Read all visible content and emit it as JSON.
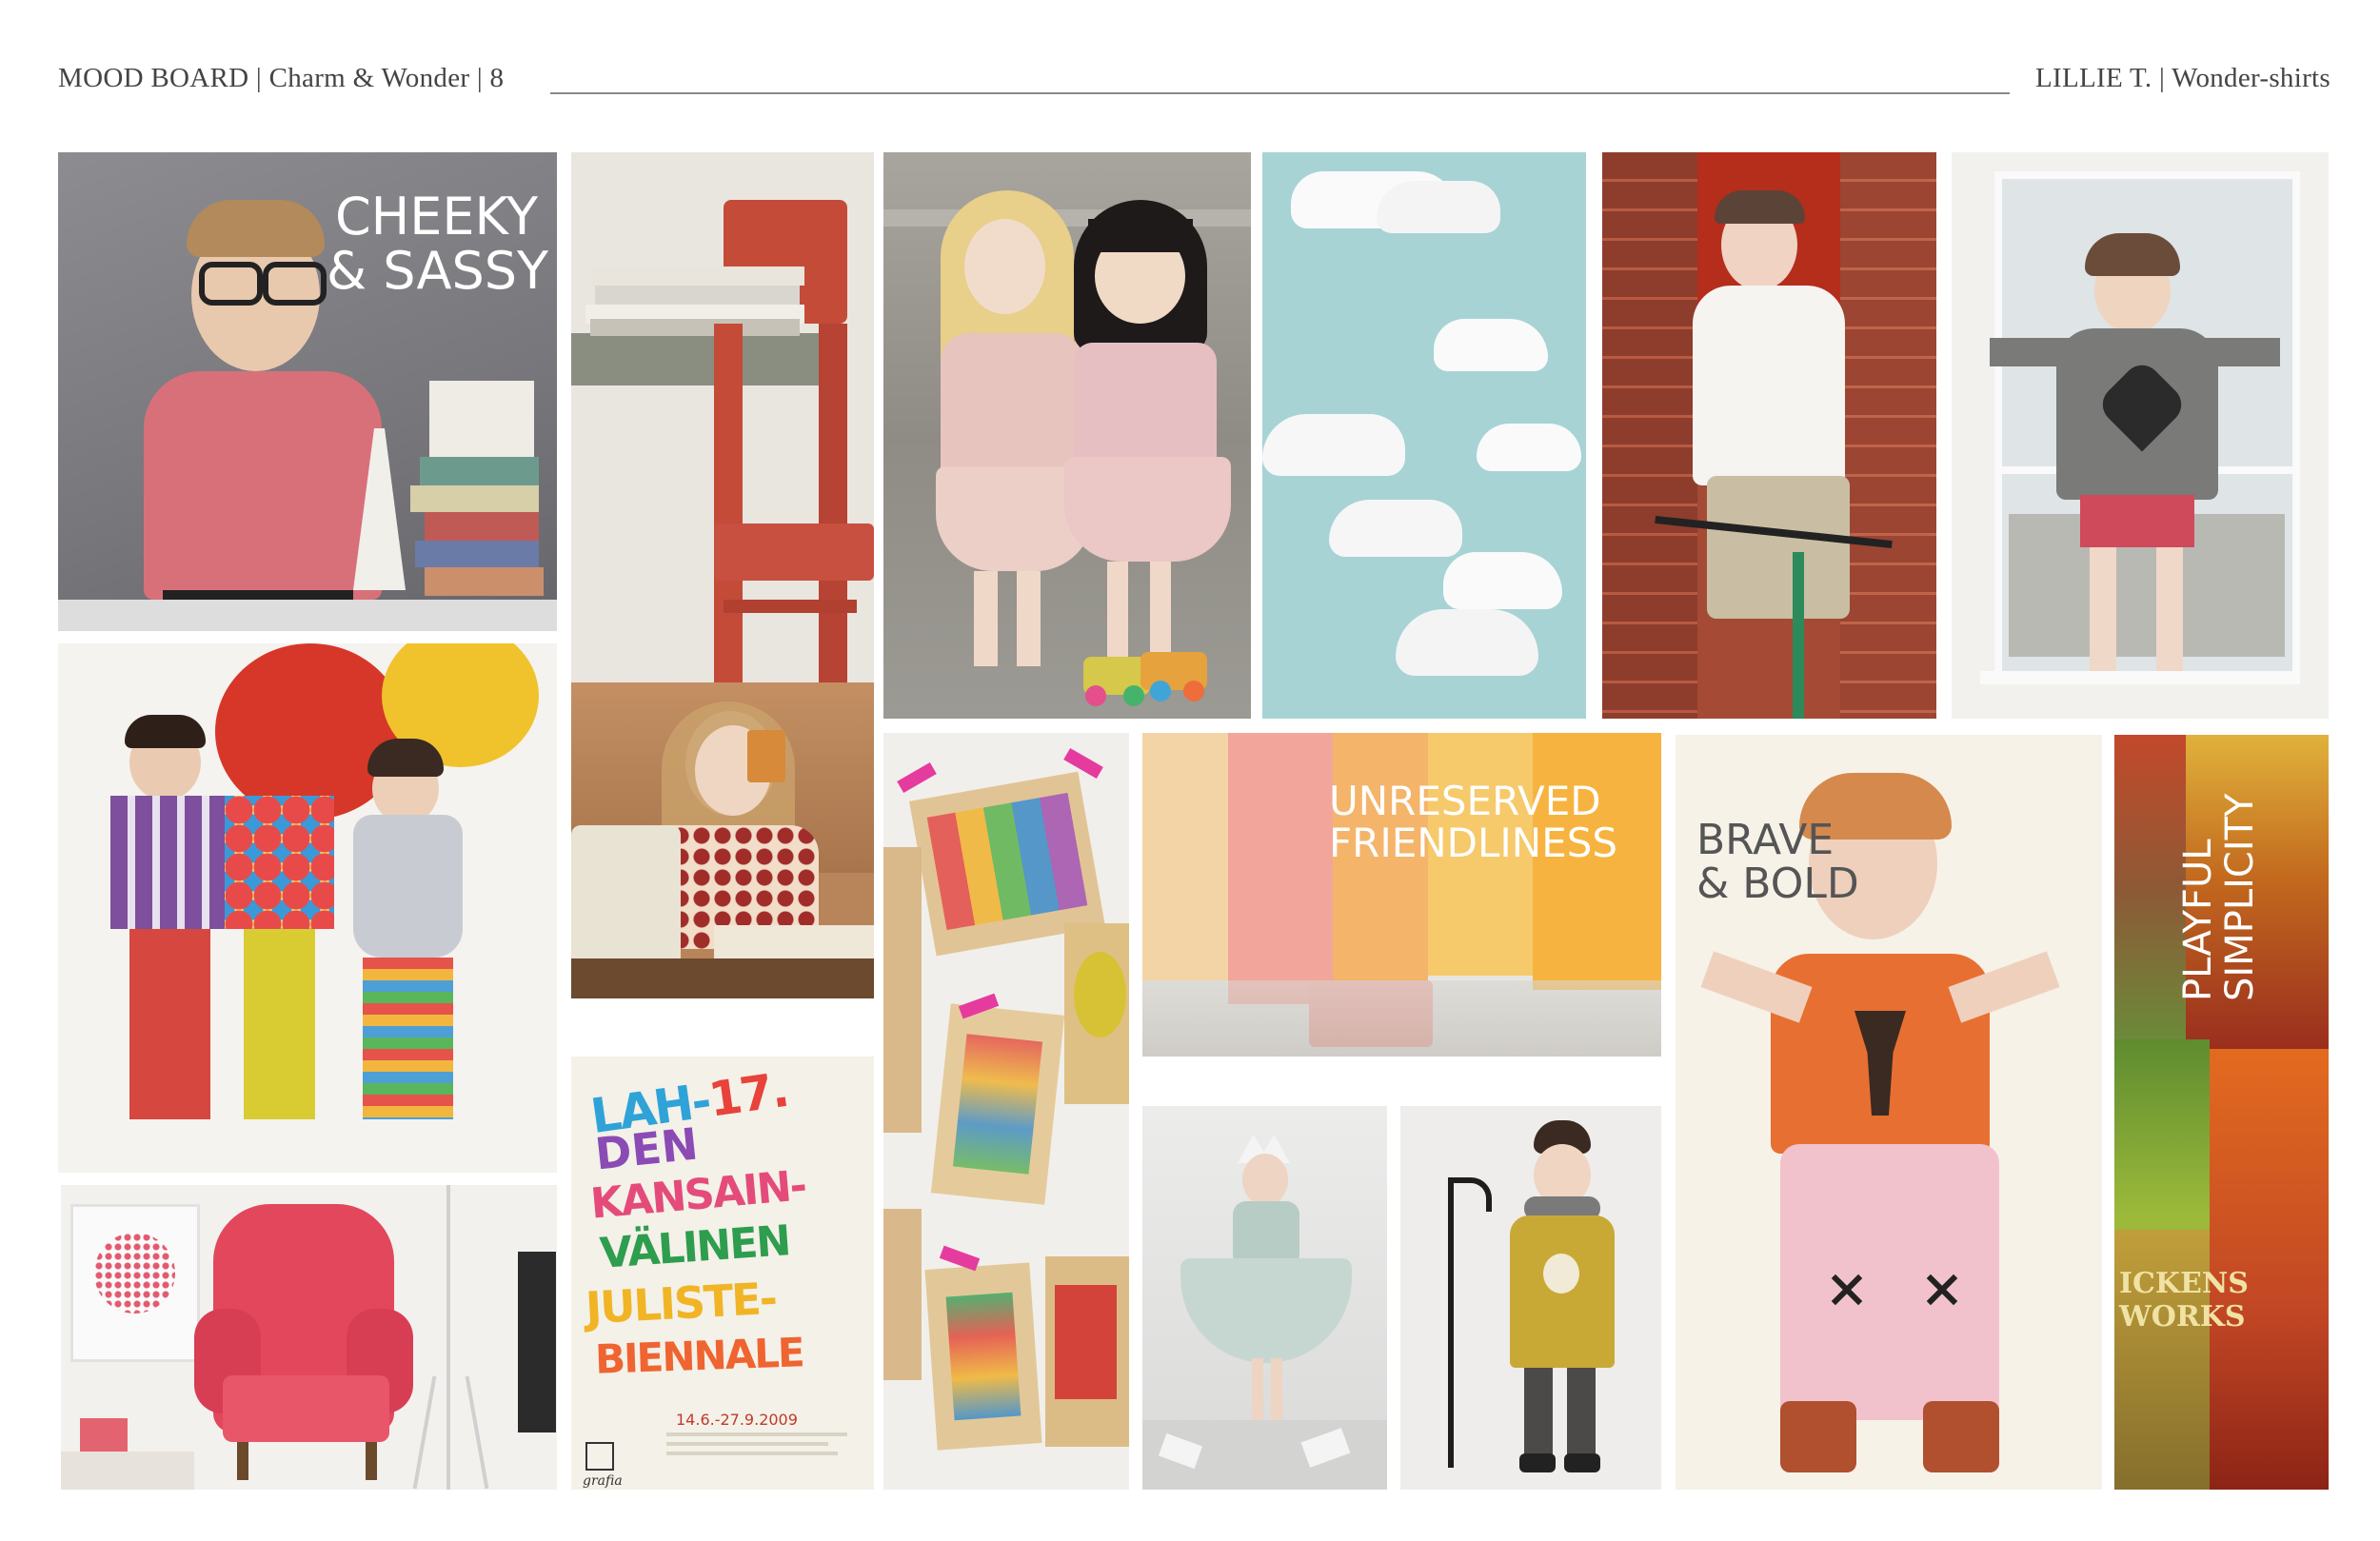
{
  "header": {
    "left": "MOOD BOARD | Charm & Wonder | 8",
    "right": "LILLIE T. | Wonder-shirts"
  },
  "captions": {
    "cheeky_line1": "CHEEKY",
    "cheeky_line2": "& SASSY",
    "unreserved_line1": "UNRESERVED",
    "unreserved_line2": "FRIENDLINESS",
    "brave_line1": "BRAVE",
    "brave_line2": "& BOLD",
    "playful_line1": "PLAYFUL",
    "playful_line2": "SIMPLICITY"
  },
  "poster": {
    "line1": "LAH-",
    "line1b": "17.",
    "line2": "DEN",
    "line3": "KANSAIN-",
    "line4": "VÄLINEN",
    "line5": "JULISTE-",
    "line6": "BIENNALE",
    "dates": "14.6.-27.9.2009",
    "brand": "grafia"
  },
  "books": {
    "spine": "ICKENS WORKS"
  },
  "colors": {
    "header_text": "#444444",
    "rule": "#8a8a8a",
    "caption_light": "#ffffff",
    "caption_dark": "#555555"
  }
}
